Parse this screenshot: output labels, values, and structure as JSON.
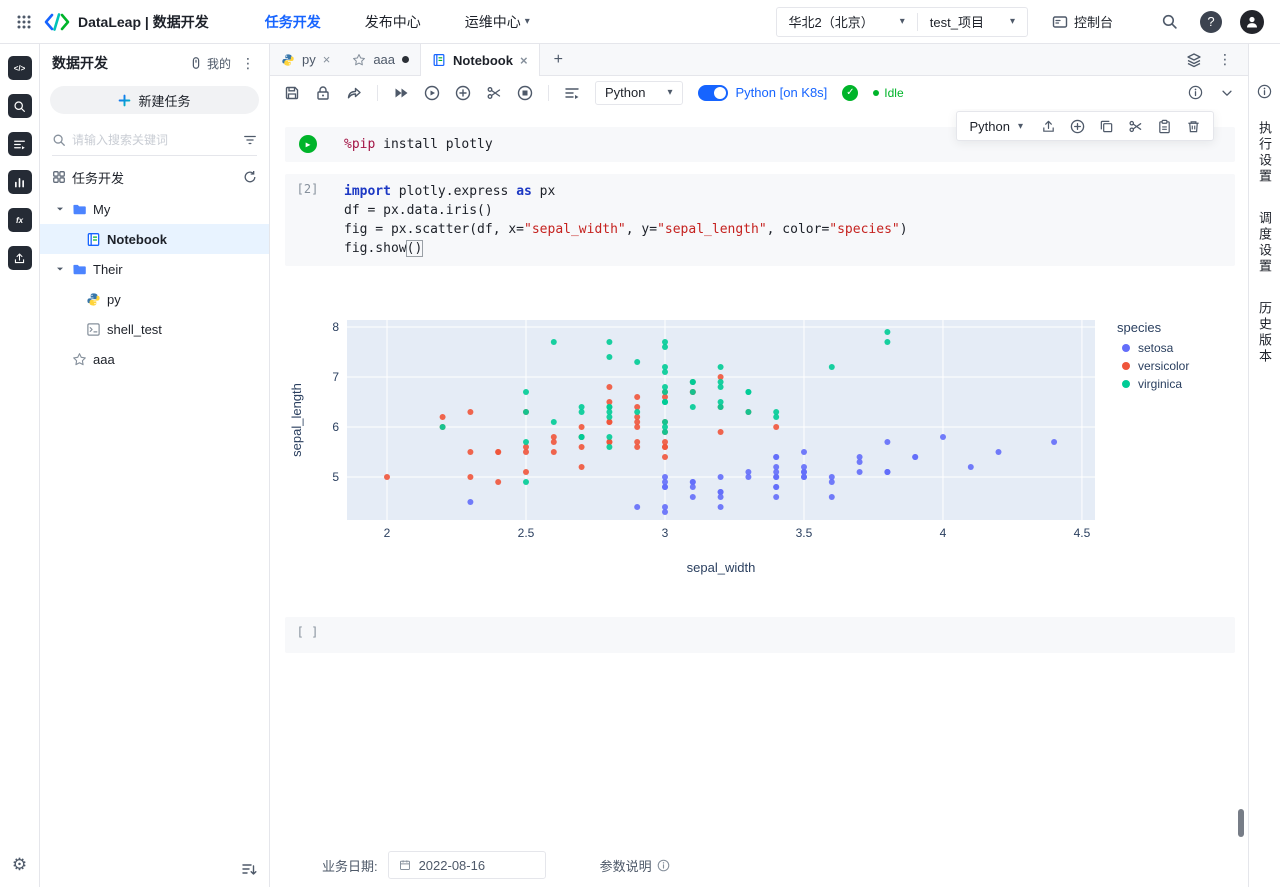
{
  "header": {
    "app_title": "DataLeap | 数据开发",
    "nav": [
      {
        "label": "任务开发",
        "active": true
      },
      {
        "label": "发布中心",
        "active": false
      },
      {
        "label": "运维中心",
        "active": false
      }
    ],
    "region": "华北2（北京）",
    "project": "test_项目",
    "console_label": "控制台",
    "help_label": "?"
  },
  "sidebar": {
    "title": "数据开发",
    "mine_label": "我的",
    "new_task_label": "新建任务",
    "search_placeholder": "请输入搜索关键词",
    "tree_header": "任务开发",
    "tree": {
      "folder_my": "My",
      "notebook": "Notebook",
      "folder_their": "Their",
      "py": "py",
      "shell_test": "shell_test",
      "aaa": "aaa"
    }
  },
  "tabbar": {
    "tabs": [
      {
        "label": "py"
      },
      {
        "label": "aaa"
      },
      {
        "label": "Notebook"
      }
    ]
  },
  "toolbar": {
    "kernel_select": "Python",
    "k8s_toggle_label": "Python [on K8s]",
    "status": "Idle"
  },
  "cell_toolbar": {
    "kernel_select": "Python"
  },
  "notebook": {
    "pip_cell": {
      "lines": [
        [
          {
            "t": "%pip",
            "c": "magic"
          },
          {
            "t": " install plotly",
            "c": "plain"
          }
        ]
      ]
    },
    "code_cell": {
      "gutter": "[2]",
      "lines": [
        [
          {
            "t": "import",
            "c": "kw"
          },
          {
            "t": " plotly.express ",
            "c": "plain"
          },
          {
            "t": "as",
            "c": "kw"
          },
          {
            "t": " px",
            "c": "plain"
          }
        ],
        [
          {
            "t": "df = px.data.iris()",
            "c": "plain"
          }
        ],
        [
          {
            "t": "fig = px.scatter(df, x=",
            "c": "plain"
          },
          {
            "t": "\"sepal_width\"",
            "c": "str"
          },
          {
            "t": ", y=",
            "c": "plain"
          },
          {
            "t": "\"sepal_length\"",
            "c": "str"
          },
          {
            "t": ", color=",
            "c": "plain"
          },
          {
            "t": "\"species\"",
            "c": "str"
          },
          {
            "t": ")",
            "c": "plain"
          }
        ],
        [
          {
            "t": "fig.show",
            "c": "plain"
          },
          {
            "t": "()",
            "c": "cursor"
          }
        ]
      ]
    },
    "empty_cell_gutter": "[ ]"
  },
  "chart_data": {
    "type": "scatter",
    "xlabel": "sepal_width",
    "ylabel": "sepal_length",
    "legend_title": "species",
    "legend_position": "right",
    "grid": true,
    "plot_bg": "#e5ecf6",
    "x_ticks": [
      2,
      2.5,
      3,
      3.5,
      4,
      4.5
    ],
    "y_ticks": [
      5,
      6,
      7,
      8
    ],
    "xlim": [
      1.856,
      4.547
    ],
    "ylim": [
      4.14,
      8.14
    ],
    "series": [
      {
        "name": "setosa",
        "color": "#636efa",
        "x": [
          3.5,
          3.0,
          3.2,
          3.1,
          3.6,
          3.9,
          3.4,
          3.4,
          2.9,
          3.1,
          3.7,
          3.4,
          3.0,
          3.0,
          4.0,
          4.4,
          3.9,
          3.5,
          3.8,
          3.8,
          3.4,
          3.7,
          3.6,
          3.3,
          3.4,
          3.0,
          3.4,
          3.5,
          3.4,
          3.2,
          3.1,
          3.4,
          4.1,
          4.2,
          3.1,
          3.2,
          3.5,
          3.6,
          3.0,
          3.4,
          3.5,
          2.3,
          3.2,
          3.5,
          3.8,
          3.0,
          3.8,
          3.2,
          3.7,
          3.3
        ],
        "y": [
          5.1,
          4.9,
          4.7,
          4.6,
          5.0,
          5.4,
          4.6,
          5.0,
          4.4,
          4.9,
          5.4,
          4.8,
          4.8,
          4.3,
          5.8,
          5.7,
          5.4,
          5.1,
          5.7,
          5.1,
          5.4,
          5.1,
          4.6,
          5.1,
          4.8,
          5.0,
          5.0,
          5.2,
          5.2,
          4.7,
          4.8,
          5.4,
          5.2,
          5.5,
          4.9,
          5.0,
          5.5,
          4.9,
          4.4,
          5.1,
          5.0,
          4.5,
          4.4,
          5.0,
          5.1,
          4.8,
          5.1,
          4.6,
          5.3,
          5.0
        ]
      },
      {
        "name": "versicolor",
        "color": "#EF553B",
        "x": [
          3.2,
          3.2,
          3.1,
          2.3,
          2.8,
          2.8,
          3.3,
          2.4,
          2.9,
          2.7,
          2.0,
          3.0,
          2.2,
          2.9,
          2.9,
          3.1,
          3.0,
          2.7,
          2.2,
          2.5,
          3.2,
          2.8,
          2.5,
          2.8,
          2.9,
          3.0,
          2.8,
          3.0,
          2.9,
          2.6,
          2.4,
          2.4,
          2.7,
          2.7,
          3.0,
          3.4,
          3.1,
          2.3,
          3.0,
          2.5,
          2.6,
          3.0,
          2.6,
          2.3,
          2.7,
          3.0,
          2.9,
          2.9,
          2.5,
          2.8
        ],
        "y": [
          7.0,
          6.4,
          6.9,
          5.5,
          6.5,
          5.7,
          6.3,
          4.9,
          6.6,
          5.2,
          5.0,
          5.9,
          6.0,
          6.1,
          5.6,
          6.7,
          5.6,
          5.8,
          6.2,
          5.6,
          5.9,
          6.1,
          6.3,
          6.1,
          6.4,
          6.6,
          6.8,
          6.7,
          6.0,
          5.7,
          5.5,
          5.5,
          5.8,
          6.0,
          5.4,
          6.0,
          6.7,
          6.3,
          5.6,
          5.5,
          5.5,
          6.1,
          5.8,
          5.0,
          5.6,
          5.7,
          5.7,
          6.2,
          5.1,
          5.7
        ]
      },
      {
        "name": "virginica",
        "color": "#00cc96",
        "x": [
          3.3,
          2.7,
          3.0,
          2.9,
          3.0,
          3.0,
          2.5,
          2.9,
          2.5,
          3.6,
          3.2,
          2.7,
          3.0,
          2.5,
          2.8,
          3.2,
          3.0,
          3.8,
          2.6,
          2.2,
          3.2,
          2.8,
          2.8,
          2.7,
          3.3,
          3.2,
          2.8,
          3.0,
          2.8,
          3.0,
          2.8,
          3.8,
          2.8,
          2.8,
          2.6,
          3.0,
          3.4,
          3.1,
          3.0,
          3.1,
          3.1,
          3.1,
          2.7,
          3.2,
          3.3,
          3.0,
          2.5,
          3.0,
          3.4,
          3.0
        ],
        "y": [
          6.3,
          5.8,
          7.1,
          6.3,
          6.5,
          7.6,
          4.9,
          7.3,
          6.7,
          7.2,
          6.5,
          6.4,
          6.8,
          5.7,
          5.8,
          6.4,
          6.5,
          7.7,
          7.7,
          6.0,
          6.9,
          5.6,
          7.7,
          6.3,
          6.7,
          7.2,
          6.2,
          6.1,
          6.4,
          7.2,
          7.4,
          7.9,
          6.4,
          6.3,
          6.1,
          7.7,
          6.3,
          6.4,
          6.0,
          6.9,
          6.7,
          6.9,
          5.8,
          6.8,
          6.7,
          6.7,
          6.3,
          6.5,
          6.2,
          5.9
        ]
      }
    ]
  },
  "right_panel": {
    "tabs": [
      "执行设置",
      "调度设置",
      "历史版本"
    ]
  },
  "footer": {
    "business_date_label": "业务日期:",
    "business_date_value": "2022-08-16",
    "params_label": "参数说明"
  },
  "icons": {
    "close": "×",
    "plus": "+",
    "caret": "▾",
    "dots_v": "⋮",
    "gear": "⚙",
    "check": "✓",
    "play": "▶"
  },
  "colors": {
    "accent": "#1664ff",
    "success": "#00b42a",
    "plot_bg": "#e5ecf6"
  }
}
